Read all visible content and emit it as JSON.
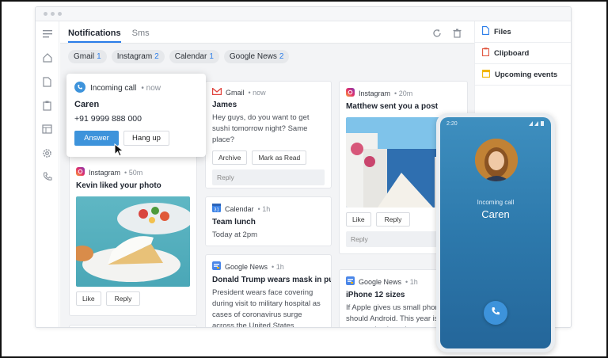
{
  "tabs": {
    "notifications": "Notifications",
    "sms": "Sms"
  },
  "chips": [
    {
      "label": "Gmail",
      "count": "1"
    },
    {
      "label": "Instagram",
      "count": "2"
    },
    {
      "label": "Calendar",
      "count": "1"
    },
    {
      "label": "Google News",
      "count": "2"
    }
  ],
  "popup": {
    "app": "Incoming call",
    "time": "now",
    "name": "Caren",
    "number": "+91 9999 888 000",
    "answer": "Answer",
    "hangup": "Hang up"
  },
  "cards": {
    "insta1": {
      "app": "Instagram",
      "time": "50m",
      "title": "Kevin liked your photo",
      "like": "Like",
      "reply": "Reply"
    },
    "gmail": {
      "app": "Gmail",
      "time": "now",
      "title": "James",
      "body": "Hey guys, do you want to get sushi tomorrow night? Same place?",
      "archive": "Archive",
      "mark": "Mark as Read",
      "reply_placeholder": "Reply"
    },
    "calendar": {
      "app": "Calendar",
      "time": "1h",
      "title": "Team lunch",
      "body": "Today at 2pm"
    },
    "gnews1": {
      "app": "Google News",
      "time": "1h",
      "title": "Donald Trump wears mask in pu...",
      "body": "President wears face covering during visit to military hospital as cases of coronavirus surge across the United States"
    },
    "insta2": {
      "app": "Instagram",
      "time": "20m",
      "title": "Matthew sent you a post",
      "like": "Like",
      "reply": "Reply",
      "reply_placeholder": "Reply"
    },
    "gnews2": {
      "app": "Google News",
      "time": "1h",
      "title": "iPhone 12 sizes",
      "body": "If Apple gives us small phone so should Android. This year is expected to launch more"
    }
  },
  "right_panel": [
    {
      "label": "Files",
      "icon": "file-icon",
      "color": "#2b7de9"
    },
    {
      "label": "Clipboard",
      "icon": "clipboard-icon",
      "color": "#e0533c"
    },
    {
      "label": "Upcoming events",
      "icon": "calendar-icon",
      "color": "#f2b400"
    }
  ],
  "phone": {
    "time": "2:20",
    "caption": "Incoming call",
    "name": "Caren"
  },
  "colors": {
    "accent": "#2b7de9",
    "phone_bg": "#2d79ac",
    "call_button": "#3d93db"
  }
}
